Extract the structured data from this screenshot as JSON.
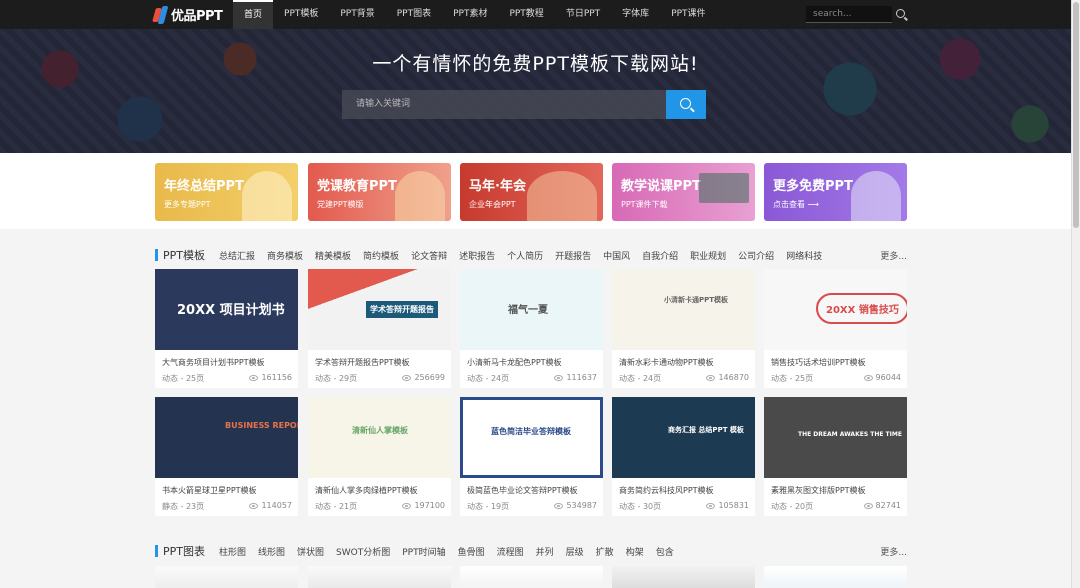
{
  "nav": {
    "logo": "优品PPT",
    "items": [
      {
        "label": "首页",
        "active": true
      },
      {
        "label": "PPT模板"
      },
      {
        "label": "PPT背景"
      },
      {
        "label": "PPT图表"
      },
      {
        "label": "PPT素材"
      },
      {
        "label": "PPT教程"
      },
      {
        "label": "节日PPT"
      },
      {
        "label": "字体库"
      },
      {
        "label": "PPT课件"
      }
    ],
    "search_placeholder": "search..."
  },
  "hero": {
    "title": "一个有情怀的免费PPT模板下载网站!",
    "search_placeholder": "请输入关键词"
  },
  "banners": [
    {
      "title": "年终总结PPT",
      "sub": "更多专题PPT",
      "bg": "#e9b94a"
    },
    {
      "title": "党课教育PPT",
      "sub": "党建PPT模版",
      "bg": "#e25a4e"
    },
    {
      "title": "马年·年会",
      "sub": "企业年会PPT",
      "bg": "#c73a2e"
    },
    {
      "title": "教学说课PPT",
      "sub": "PPT课件下载",
      "bg": "#d869b6"
    },
    {
      "title": "更多免费PPT",
      "sub": "点击查看 ⟶",
      "bg": "#8a58d6"
    }
  ],
  "ppt_section": {
    "title": "PPT模板",
    "tags": [
      "总结汇报",
      "商务模板",
      "精美模板",
      "简约模板",
      "论文答辩",
      "述职报告",
      "个人简历",
      "开题报告",
      "中国风",
      "自我介绍",
      "职业规划",
      "公司介绍",
      "网络科技"
    ],
    "more": "更多...",
    "cards": [
      {
        "name": "大气商务项目计划书PPT模板",
        "meta": "动态 - 25页",
        "views": "161156",
        "thumb_text": "20XX 项目计划书",
        "bg": "#2b3a5c",
        "fg": "#ffffff"
      },
      {
        "name": "学术答辩开题报告PPT模板",
        "meta": "动态 - 29页",
        "views": "256699",
        "thumb_text": "学术答辩开题报告",
        "bg": "#f2f2f2",
        "fg": "#ffffff"
      },
      {
        "name": "小清新马卡龙配色PPT模板",
        "meta": "动态 - 24页",
        "views": "111637",
        "thumb_text": "福气一夏",
        "bg": "#eaf6f8",
        "fg": "#555555"
      },
      {
        "name": "清新水彩卡通动物PPT模板",
        "meta": "动态 - 24页",
        "views": "146870",
        "thumb_text": "小清新卡通PPT模板",
        "bg": "#f6f3ea",
        "fg": "#666666"
      },
      {
        "name": "销售技巧话术培训PPT模板",
        "meta": "动态 - 25页",
        "views": "96044",
        "thumb_text": "20XX 销售技巧",
        "bg": "#f7f7f7",
        "fg": "#d94b4b"
      },
      {
        "name": "书本火箭星球卫星PPT模板",
        "meta": "静态 - 23页",
        "views": "114057",
        "thumb_text": "BUSINESS REPORT",
        "bg": "#24334f",
        "fg": "#e8734a"
      },
      {
        "name": "清新仙人掌多肉绿植PPT模板",
        "meta": "动态 - 21页",
        "views": "197100",
        "thumb_text": "清新仙人掌模板",
        "bg": "#f6f5e8",
        "fg": "#6aa66a"
      },
      {
        "name": "极简蓝色毕业论文答辩PPT模板",
        "meta": "动态 - 19页",
        "views": "534987",
        "thumb_text": "蓝色简洁毕业答辩模板",
        "bg": "#ffffff",
        "fg": "#2b4a8a"
      },
      {
        "name": "商务简约云科技风PPT模板",
        "meta": "动态 - 30页",
        "views": "105831",
        "thumb_text": "商务汇报 总结PPT 模板",
        "bg": "#1c3a52",
        "fg": "#ffffff"
      },
      {
        "name": "素雅黑灰图文排版PPT模板",
        "meta": "动态 - 20页",
        "views": "82741",
        "thumb_text": "THE DREAM AWAKES THE TIME",
        "bg": "#4a4a4a",
        "fg": "#ffffff"
      }
    ]
  },
  "chart_section": {
    "title": "PPT图表",
    "tags": [
      "柱形图",
      "线形图",
      "饼状图",
      "SWOT分析图",
      "PPT时间轴",
      "鱼骨图",
      "流程图",
      "并列",
      "层级",
      "扩散",
      "构架",
      "包含"
    ],
    "more": "更多..."
  }
}
